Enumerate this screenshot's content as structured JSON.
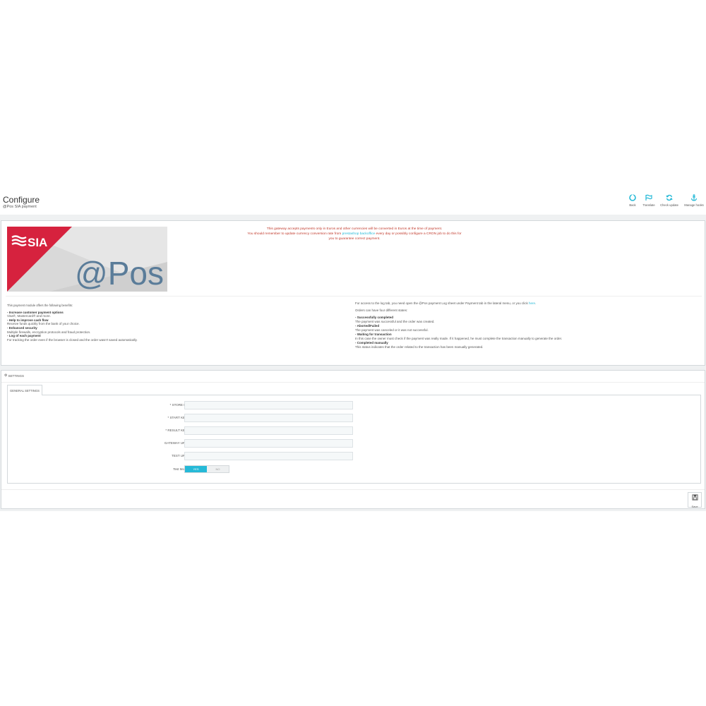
{
  "header": {
    "title": "Configure",
    "subtitle": "@Pos SIA payment",
    "toolbar": [
      {
        "label": "Back",
        "icon": "back-icon"
      },
      {
        "label": "Translate",
        "icon": "flag-icon"
      },
      {
        "label": "Check update",
        "icon": "refresh-icon"
      },
      {
        "label": "Manage hooks",
        "icon": "anchor-icon"
      }
    ]
  },
  "logo": {
    "brand": "SIA",
    "product": "@Pos"
  },
  "notice": {
    "line1": "This gateway accepts payments only in Euros and other currencies will be converted in Euros at the time of payment.",
    "line2_prefix": "You should remember to update currency conversion rate from",
    "line2_link": "prestashop backoffice",
    "line2_suffix": "every day or possibly configure a CRON job to do this for",
    "line3": "you to guarantee correct payment."
  },
  "benefits": {
    "intro": "This payment module offers the following benefits:",
    "items": [
      {
        "title": "- Increase customer payment options",
        "desc": "Visa®, Mastercard® and more."
      },
      {
        "title": "- Help to improve cash flow",
        "desc": "Receive funds quickly from the bank of your choice."
      },
      {
        "title": "- Enhanced security",
        "desc": "Multiple firewalls, encryption protocols and fraud protection."
      },
      {
        "title": "- Log of each payment",
        "desc": "For tracking the order even if the browser is closed and the order wasn't saved automatically."
      }
    ]
  },
  "states": {
    "access_prefix": "For access to the log tab, you need open the @Pos payment Log sheet under Payment tab in the lateral menu, or you click",
    "access_link": "here",
    "intro": "Orders can have four different states:",
    "items": [
      {
        "title": "- Successfully completed",
        "desc": "The payment was successful and the order was created."
      },
      {
        "title": "- Aborted/Failed",
        "desc": "The payment was canceled or it was not successful."
      },
      {
        "title": "- Waiting for transaction",
        "desc": "In this case the owner must check if the payment was really made. If it happened, he must complete the transaction manually to generate the order."
      },
      {
        "title": "- Completed manually",
        "desc": "This status indicates that the order related to the transaction has been manually generated."
      }
    ]
  },
  "settings": {
    "heading": "SETTINGS",
    "tab": "GENERAL SETTINGS",
    "fields": [
      {
        "label": "* STORE ID:",
        "value": ""
      },
      {
        "label": "* START KEY:",
        "value": ""
      },
      {
        "label": "* RESULT KEY:",
        "value": ""
      },
      {
        "label": "GATEWAY URL:",
        "value": ""
      },
      {
        "label": "TEST URL:",
        "value": ""
      }
    ],
    "test_mode": {
      "label": "Test Mode",
      "yes": "YES",
      "no": "NO",
      "selected": "YES"
    },
    "save_label": "Save"
  },
  "colors": {
    "accent": "#25b9d7",
    "notice": "#c0392b",
    "sia_red": "#d6223e",
    "pos_blue": "#5a7c99"
  }
}
